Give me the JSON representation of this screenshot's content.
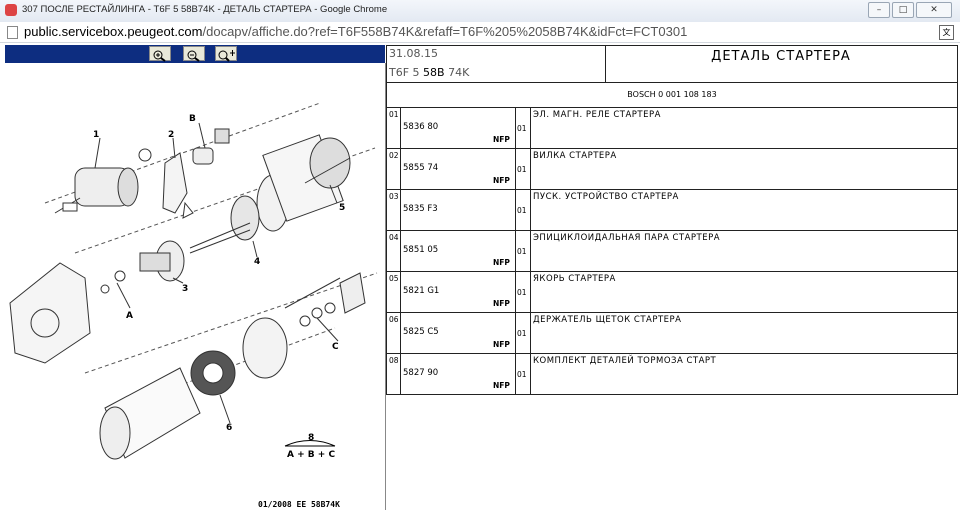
{
  "window": {
    "title": "307 ПОСЛЕ РЕСТАЙЛИНГА - T6F 5 58B74K - ДЕТАЛЬ СТАРТЕРА - Google Chrome",
    "min": "–",
    "max": "□",
    "close": "✕"
  },
  "address": {
    "host": "public.servicebox.peugeot.com",
    "path": "/docapv/affiche.do?ref=T6F558B74K&refaff=T6F%205%2058B74K&idFct=FCT0301"
  },
  "toolbar": {
    "zoom_in_icon": "zoom-in",
    "zoom_out_icon": "zoom-out",
    "zoom_pan_icon": "zoom-move"
  },
  "diagram": {
    "labels": [
      "1",
      "2",
      "B",
      "5",
      "4",
      "3",
      "A",
      "C",
      "6",
      "8"
    ],
    "formula": "A + B + C",
    "footer": "01/2008   EE 58B74K"
  },
  "header": {
    "date": "31.08.15",
    "model_prefix": "T6F 5 ",
    "model_bold": "58B",
    "model_suffix": " 74K",
    "title": "ДЕТАЛЬ СТАРТЕРА"
  },
  "brand": "BOSCH 0 001 108 183",
  "parts": [
    {
      "idx": "01",
      "ref": "5836 80",
      "nfp": "NFP",
      "qty": "01",
      "desc": "ЭЛ. МАГН. РЕЛЕ СТАРТЕРА"
    },
    {
      "idx": "02",
      "ref": "5855 74",
      "nfp": "NFP",
      "qty": "01",
      "desc": "ВИЛКА СТАРТЕРА"
    },
    {
      "idx": "03",
      "ref": "5835 F3",
      "nfp": "",
      "qty": "01",
      "desc": "ПУСК. УСТРОЙСТВО СТАРТЕРА"
    },
    {
      "idx": "04",
      "ref": "5851 05",
      "nfp": "NFP",
      "qty": "01",
      "desc": "ЭПИЦИКЛОИДАЛЬНАЯ ПАРА СТАРТЕРА"
    },
    {
      "idx": "05",
      "ref": "5821 G1",
      "nfp": "NFP",
      "qty": "01",
      "desc": "ЯКОРЬ СТАРТЕРА"
    },
    {
      "idx": "06",
      "ref": "5825 C5",
      "nfp": "NFP",
      "qty": "01",
      "desc": "ДЕРЖАТЕЛЬ ЩЕТОК СТАРТЕРА"
    },
    {
      "idx": "08",
      "ref": "5827 90",
      "nfp": "NFP",
      "qty": "01",
      "desc": "КОМПЛЕКТ ДЕТАЛЕЙ ТОРМОЗА СТАРТ"
    }
  ]
}
